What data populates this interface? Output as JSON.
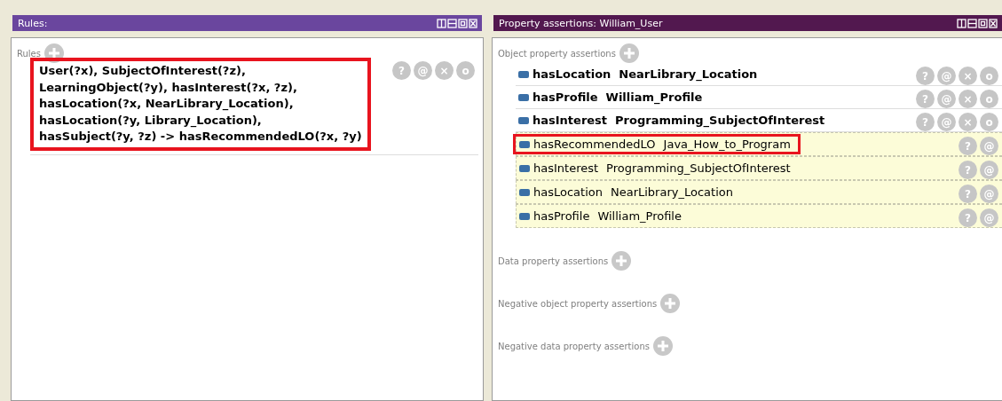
{
  "rules_panel": {
    "title": "Rules:",
    "section": "Rules",
    "rule": {
      "highlighted": true,
      "lines": [
        "User(?x), SubjectOfInterest(?z),",
        "LearningObject(?y), hasInterest(?x, ?z),",
        "hasLocation(?x, NearLibrary_Location),",
        "hasLocation(?y, Library_Location),",
        "hasSubject(?y, ?z) -> hasRecommendedLO(?x, ?y)"
      ],
      "actions": [
        "?",
        "@",
        "×",
        "o"
      ]
    }
  },
  "assertions_panel": {
    "title": "Property assertions: William_User",
    "object_property_assertions": {
      "label": "Object property assertions",
      "rows": [
        {
          "kind": "asserted",
          "property": "hasLocation",
          "value": "NearLibrary_Location",
          "highlighted": false,
          "actions": [
            "?",
            "@",
            "×",
            "o"
          ]
        },
        {
          "kind": "asserted",
          "property": "hasProfile",
          "value": "William_Profile",
          "highlighted": false,
          "actions": [
            "?",
            "@",
            "×",
            "o"
          ]
        },
        {
          "kind": "asserted",
          "property": "hasInterest",
          "value": "Programming_SubjectOfInterest",
          "highlighted": false,
          "actions": [
            "?",
            "@",
            "×",
            "o"
          ]
        },
        {
          "kind": "inferred",
          "property": "hasRecommendedLO",
          "value": "Java_How_to_Program",
          "highlighted": true,
          "actions": [
            "?",
            "@"
          ]
        },
        {
          "kind": "inferred",
          "property": "hasInterest",
          "value": "Programming_SubjectOfInterest",
          "highlighted": false,
          "actions": [
            "?",
            "@"
          ]
        },
        {
          "kind": "inferred",
          "property": "hasLocation",
          "value": "NearLibrary_Location",
          "highlighted": false,
          "actions": [
            "?",
            "@"
          ]
        },
        {
          "kind": "inferred",
          "property": "hasProfile",
          "value": "William_Profile",
          "highlighted": false,
          "actions": [
            "?",
            "@"
          ]
        }
      ]
    },
    "other_sections": [
      "Data property assertions",
      "Negative object property assertions",
      "Negative data property assertions"
    ]
  }
}
